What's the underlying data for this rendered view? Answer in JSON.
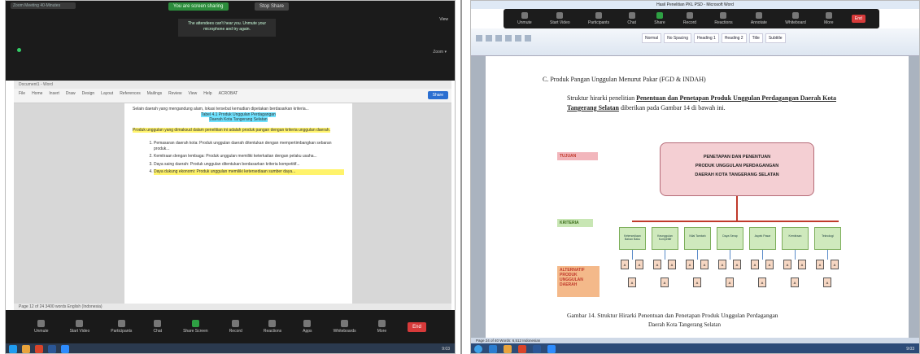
{
  "left": {
    "window_title": "Zoom Meeting 40-Minutes",
    "share_banner": "You are screen sharing",
    "stop_share": "Stop Share",
    "notice": "The attendees can't hear you. Unmute your microphone and try again.",
    "view_label": "View",
    "right_label": "Zoom ▾",
    "word_ribbon_tabs": [
      "File",
      "Home",
      "Insert",
      "Draw",
      "Design",
      "Layout",
      "References",
      "Mailings",
      "Review",
      "View",
      "Help",
      "ACROBAT"
    ],
    "share_btn": "Share",
    "doc_lines": [
      "Tabel 4.1 Produk Unggulan Perdagangan",
      "Daerah Kota Tangerang Selatan"
    ],
    "list_items": [
      "Pemasaran daerah kota: Produk unggulan daerah ditentukan dengan mempertimbangkan sebaran produk...",
      "Kemitraan dengan lembaga: Produk unggulan memiliki keterkaitan dengan pelaku usaha...",
      "Daya saing daerah: Produk unggulan ditentukan berdasarkan kriteria kompetitif...",
      "Daya dukung ekonomi: Produk unggulan memiliki ketersediaan sumber daya..."
    ],
    "status_text": "Page 12 of 24   3400 words   English (Indonesia)",
    "toolbar": [
      {
        "label": "Unmute",
        "icon": "mic-icon"
      },
      {
        "label": "Start Video",
        "icon": "video-icon"
      },
      {
        "label": "Participants",
        "icon": "participants-icon"
      },
      {
        "label": "Chat",
        "icon": "chat-icon"
      },
      {
        "label": "Share Screen",
        "icon": "share-icon"
      },
      {
        "label": "Record",
        "icon": "record-icon"
      },
      {
        "label": "Reactions",
        "icon": "reactions-icon"
      },
      {
        "label": "Apps",
        "icon": "apps-icon"
      },
      {
        "label": "Whiteboards",
        "icon": "whiteboard-icon"
      },
      {
        "label": "More",
        "icon": "more-icon"
      }
    ],
    "end_label": "End",
    "clock": "9:03"
  },
  "right": {
    "window_title": "Hasil Penelitian PKL PSD - Microsoft Word",
    "toolbar": [
      {
        "label": "Unmute",
        "icon": "mic-icon"
      },
      {
        "label": "Start Video",
        "icon": "video-icon"
      },
      {
        "label": "Participants",
        "icon": "participants-icon"
      },
      {
        "label": "Chat",
        "icon": "chat-icon"
      },
      {
        "label": "Share",
        "icon": "share-icon"
      },
      {
        "label": "Record",
        "icon": "record-icon"
      },
      {
        "label": "Reactions",
        "icon": "reactions-icon"
      },
      {
        "label": "Annotate",
        "icon": "annotate-icon"
      },
      {
        "label": "Whiteboard",
        "icon": "whiteboard-icon"
      },
      {
        "label": "More",
        "icon": "more-icon"
      }
    ],
    "end_label": "End",
    "styles": [
      "Normal",
      "No Spacing",
      "Heading 1",
      "Heading 2",
      "Title",
      "Subtitle"
    ],
    "heading": "C. Produk Pangan Unggulan Menurut Pakar (FGD & INDAH)",
    "para_prefix": "Struktur hirarki penelitian ",
    "para_bold": "Penentuan dan Penetapan Produk Unggulan Perdagangan Daerah Kota Tangerang Selatan",
    "para_suffix": " diberikan pada Gambar 14 di bawah ini.",
    "label_tujuan": "TUJUAN",
    "label_kriteria": "KRITERIA",
    "label_alternatif": "ALTERNATIF PRODUK UNGGULAN DAERAH",
    "goal_lines": [
      "PENETAPAN DAN PENENTUAN",
      "PRODUK UNGGULAN PERDAGANGAN",
      "DAERAH KOTA TANGERANG SELATAN"
    ],
    "criteria": [
      "Ketersediaan Bahan Baku",
      "Keunggulan Kompetitif",
      "Nilai Tambah",
      "Daya Serap",
      "Aspek Pasar",
      "Kemitraan",
      "Teknologi"
    ],
    "caption": "Gambar 14. Struktur Hirarki Penentuan dan Penetapan Produk Unggulan Perdagangan",
    "caption2": "Daerah Kota Tangerang Selatan",
    "status": "Page 24 of 40   Words: 6,512   Indonesian",
    "clock": "9:03"
  }
}
